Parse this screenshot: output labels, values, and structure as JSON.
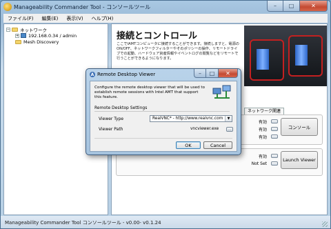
{
  "window": {
    "title": "Manageability Commander Tool - コンソールツール",
    "caption_buttons": {
      "minimize": "–",
      "maximize": "□",
      "close": "✕"
    }
  },
  "menu": [
    "ファイル(F)",
    "編集(E)",
    "表示(V)",
    "ヘルプ(H)"
  ],
  "tree": {
    "root": "ネットワーク",
    "host": "192.168.0.34 / admin",
    "discovery": "Mesh Discovery",
    "expander": "+"
  },
  "main": {
    "title": "接続とコントロール",
    "description": "ここでIAMTコンピュータに接続することができます。接続しますと、電源のON/OFF、ネットワークフィルターやそのポリシーの操作、リモートドライブでの起動、ハードウェア資産情報やイベントログの閲覧などをリモートで行うことができるようになります。",
    "tab_label": "ネットワーク関連",
    "status_rows": [
      "有効",
      "有効",
      "有効"
    ],
    "console_button": "コンソール",
    "viewer_rows": [
      "有効",
      "Not Set"
    ],
    "launch_button": "Launch Viewer"
  },
  "dialog": {
    "title": "Remote Desktop Viewer",
    "description": "Configure the remote desktop viewer that will be used to establish remote sessions with Intel AMT that support this feature.",
    "group": "Remote Desktop Settings",
    "viewer_type_label": "Viewer Type",
    "viewer_type_value": "RealVNC* - http://www.realvnc.com",
    "viewer_path_label": "Viewer Path",
    "viewer_path_value": "vncviewer.exe",
    "browse_label": "...",
    "ok": "OK",
    "cancel": "Cancel"
  },
  "status_bar": "Manageability Commander Tool コンソールツール - v0.00- v0.1.24"
}
